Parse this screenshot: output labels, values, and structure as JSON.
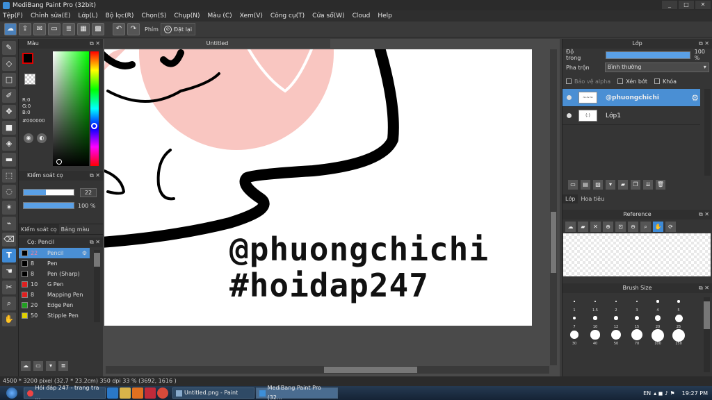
{
  "window": {
    "title": "MediBang Paint Pro (32bit)",
    "controls": [
      "_",
      "□",
      "✕"
    ]
  },
  "menu": [
    "Tệp(F)",
    "Chỉnh sửa(E)",
    "Lớp(L)",
    "Bộ lọc(R)",
    "Chọn(S)",
    "Chụp(N)",
    "Màu (C)",
    "Xem(V)",
    "Công cụ(T)",
    "Cửa sổ(W)",
    "Cloud",
    "Help"
  ],
  "toolbar": {
    "key_label": "Phím",
    "reset_label": "Đặt lại"
  },
  "color_panel": {
    "title": "Màu",
    "r": "R:0",
    "g": "G:0",
    "b": "B:0",
    "hex": "#000000"
  },
  "brush_control": {
    "title": "Kiểm soát cọ",
    "size": "22",
    "opacity": "100 %",
    "size_fraction": 0.45,
    "opacity_fraction": 1.0
  },
  "left_tabs": [
    "Kiểm soát cọ",
    "Bảng màu"
  ],
  "brush_panel": {
    "title": "Cọ: Pencil",
    "items": [
      {
        "size": "22",
        "name": "Pencil",
        "color": "#000000",
        "selected": true
      },
      {
        "size": "8",
        "name": "Pen",
        "color": "#000000"
      },
      {
        "size": "8",
        "name": "Pen (Sharp)",
        "color": "#000000"
      },
      {
        "size": "10",
        "name": "G Pen",
        "color": "#e02020"
      },
      {
        "size": "8",
        "name": "Mapping Pen",
        "color": "#e02020"
      },
      {
        "size": "20",
        "name": "Edge Pen",
        "color": "#20a020"
      },
      {
        "size": "50",
        "name": "Stipple Pen",
        "color": "#e0d000"
      }
    ]
  },
  "document": {
    "tab": "Untitled",
    "text_line1": "@phuongchichi",
    "text_line2": "#hoidap247"
  },
  "layer_panel": {
    "title": "Lớp",
    "opacity_label": "Độ trong",
    "opacity_value": "100 %",
    "blend_label": "Pha trộn",
    "blend_value": "Bình thường",
    "protect_alpha": "Bảo vệ alpha",
    "clipping": "Xén bớt",
    "lock": "Khóa",
    "layers": [
      {
        "name": "@phuongchichi",
        "selected": true
      },
      {
        "name": "Lớp1",
        "selected": false
      }
    ],
    "tabs": [
      "Lớp",
      "Hoa tiêu"
    ]
  },
  "reference": {
    "title": "Reference"
  },
  "brush_size": {
    "title": "Brush Size",
    "sizes": [
      "1",
      "1.5",
      "2",
      "3",
      "4",
      "5",
      "7",
      "10",
      "12",
      "15",
      "20",
      "25",
      "30",
      "40",
      "50",
      "70",
      "100",
      "150"
    ]
  },
  "status": {
    "text": "4500 * 3200 pixel  (32.7 * 23.2cm)  350 dpi  33 %  (3692, 1616 )"
  },
  "taskbar": {
    "tasks": [
      "Hỏi đáp 247 - trang tra ...",
      "Untitled.png - Paint",
      "MediBang Paint Pro (32..."
    ],
    "lang": "EN",
    "time": "19:27 PM"
  }
}
